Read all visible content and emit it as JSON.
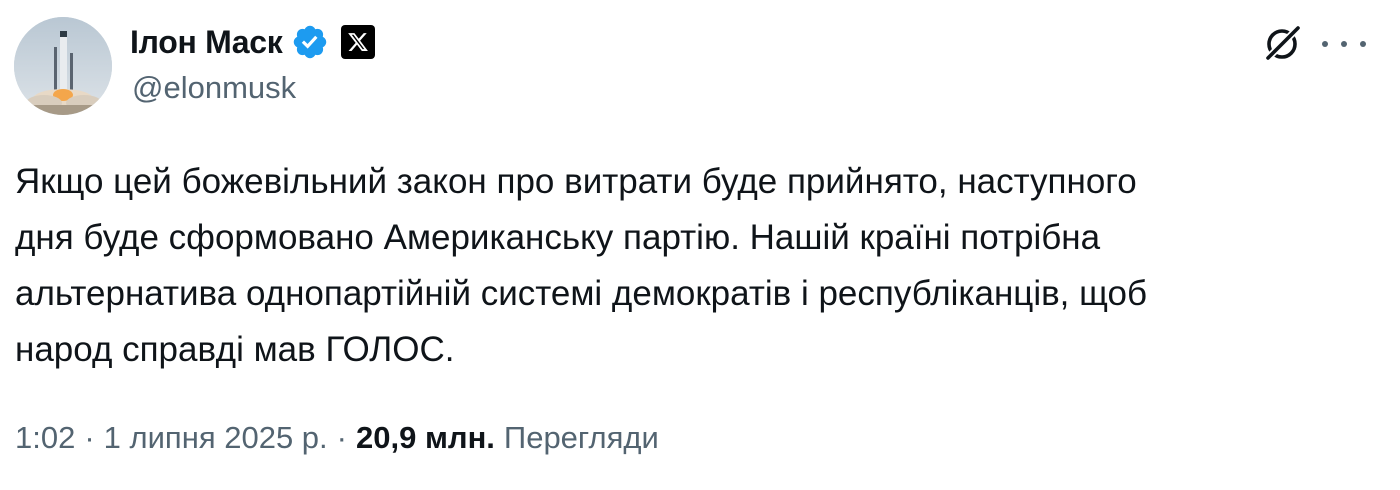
{
  "author": {
    "display_name": "Ілон Маск",
    "handle": "@elonmusk",
    "verified": true,
    "avatar": "rocket-launch-avatar",
    "affiliation_badge": "x-logo-icon"
  },
  "tweet": {
    "text": "Якщо цей божевільний закон про витрати буде прийнято, наступного\nдня буде сформовано Американську партію. Нашій країні потрібна\nальтернатива однопартійній системі демократів і республіканців, щоб\nнарод справді мав ГОЛОС."
  },
  "meta": {
    "time": "1:02",
    "separator": "·",
    "date": "1 липня 2025 р.",
    "views_count": "20,9 млн.",
    "views_label": "Перегляди"
  },
  "actions": {
    "grok_icon": "grok-icon",
    "more_icon": "more-icon"
  },
  "colors": {
    "text_primary": "#0f1419",
    "text_secondary": "#536471",
    "verified_blue": "#1d9bf0"
  }
}
